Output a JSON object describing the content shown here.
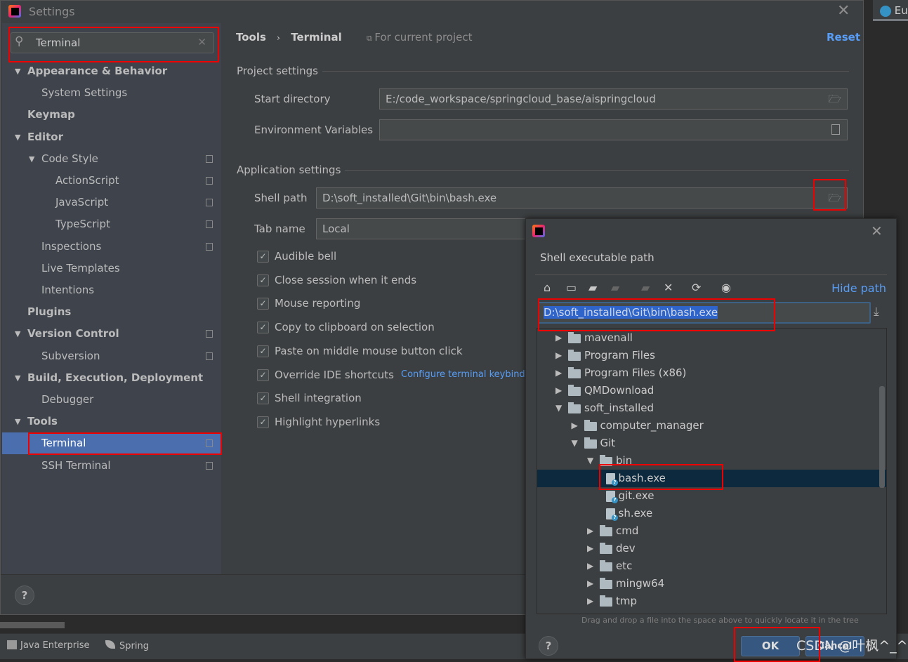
{
  "window": {
    "title": "Settings"
  },
  "search": {
    "value": "Terminal"
  },
  "breadcrumb": {
    "parent": "Tools",
    "sep": "›",
    "current": "Terminal",
    "scope": "For current project",
    "reset": "Reset"
  },
  "sidebar": {
    "items": [
      {
        "label": "Appearance & Behavior",
        "level": 0,
        "bold": true,
        "expanded": true
      },
      {
        "label": "System Settings",
        "level": 1
      },
      {
        "label": "Keymap",
        "level": 0,
        "bold": true
      },
      {
        "label": "Editor",
        "level": 0,
        "bold": true,
        "expanded": true
      },
      {
        "label": "Code Style",
        "level": 1,
        "expanded": true,
        "copy": true
      },
      {
        "label": "ActionScript",
        "level": 2,
        "copy": true
      },
      {
        "label": "JavaScript",
        "level": 2,
        "copy": true
      },
      {
        "label": "TypeScript",
        "level": 2,
        "copy": true
      },
      {
        "label": "Inspections",
        "level": 1,
        "copy": true
      },
      {
        "label": "Live Templates",
        "level": 1
      },
      {
        "label": "Intentions",
        "level": 1
      },
      {
        "label": "Plugins",
        "level": 0,
        "bold": true
      },
      {
        "label": "Version Control",
        "level": 0,
        "bold": true,
        "expanded": true,
        "copy": true
      },
      {
        "label": "Subversion",
        "level": 1,
        "copy": true
      },
      {
        "label": "Build, Execution, Deployment",
        "level": 0,
        "bold": true,
        "expanded": true
      },
      {
        "label": "Debugger",
        "level": 1
      },
      {
        "label": "Tools",
        "level": 0,
        "bold": true,
        "expanded": true
      },
      {
        "label": "Terminal",
        "level": 1,
        "selected": true,
        "copy": true
      },
      {
        "label": "SSH Terminal",
        "level": 1,
        "copy": true
      }
    ]
  },
  "project": {
    "title": "Project settings",
    "start_dir_label": "Start directory",
    "start_dir": "E:/code_workspace/springcloud_base/aispringcloud",
    "env_label": "Environment Variables",
    "env": ""
  },
  "app": {
    "title": "Application settings",
    "shell_label": "Shell path",
    "shell": "D:\\soft_installed\\Git\\bin\\bash.exe",
    "tab_label": "Tab name",
    "tab": "Local",
    "checkboxes": [
      {
        "label": "Audible bell",
        "checked": true
      },
      {
        "label": "Close session when it ends",
        "checked": true
      },
      {
        "label": "Mouse reporting",
        "checked": true
      },
      {
        "label": "Copy to clipboard on selection",
        "checked": true
      },
      {
        "label": "Paste on middle mouse button click",
        "checked": true
      },
      {
        "label": "Override IDE shortcuts",
        "checked": true
      },
      {
        "label": "Shell integration",
        "checked": true
      },
      {
        "label": "Highlight hyperlinks",
        "checked": true
      }
    ],
    "keybinding_link": "Configure terminal keybindin"
  },
  "ide": {
    "tab": "Eu",
    "status": [
      "Java Enterprise",
      "Spring"
    ]
  },
  "dialog": {
    "title": "Shell executable path",
    "hide_path": "Hide path",
    "path": "D:\\soft_installed\\Git\\bin\\bash.exe",
    "tree": [
      {
        "label": "mavenall",
        "level": 0,
        "type": "folder"
      },
      {
        "label": "Program Files",
        "level": 0,
        "type": "folder"
      },
      {
        "label": "Program Files (x86)",
        "level": 0,
        "type": "folder"
      },
      {
        "label": "QMDownload",
        "level": 0,
        "type": "folder"
      },
      {
        "label": "soft_installed",
        "level": 0,
        "type": "folder",
        "expanded": true
      },
      {
        "label": "computer_manager",
        "level": 1,
        "type": "folder"
      },
      {
        "label": "Git",
        "level": 1,
        "type": "folder",
        "expanded": true
      },
      {
        "label": "bin",
        "level": 2,
        "type": "folder",
        "expanded": true
      },
      {
        "label": "bash.exe",
        "level": 3,
        "type": "file",
        "selected": true
      },
      {
        "label": "git.exe",
        "level": 3,
        "type": "file"
      },
      {
        "label": "sh.exe",
        "level": 3,
        "type": "file"
      },
      {
        "label": "cmd",
        "level": 2,
        "type": "folder"
      },
      {
        "label": "dev",
        "level": 2,
        "type": "folder"
      },
      {
        "label": "etc",
        "level": 2,
        "type": "folder"
      },
      {
        "label": "mingw64",
        "level": 2,
        "type": "folder"
      },
      {
        "label": "tmp",
        "level": 2,
        "type": "folder"
      }
    ],
    "hint": "Drag and drop a file into the space above to quickly locate it in the tree",
    "ok": "OK",
    "cancel": "Cancel"
  },
  "watermark": "CSDN @叶枫^_^",
  "colors": {
    "accent": "#4b6eaf",
    "link": "#589df6",
    "highlight": "#ff0000"
  }
}
